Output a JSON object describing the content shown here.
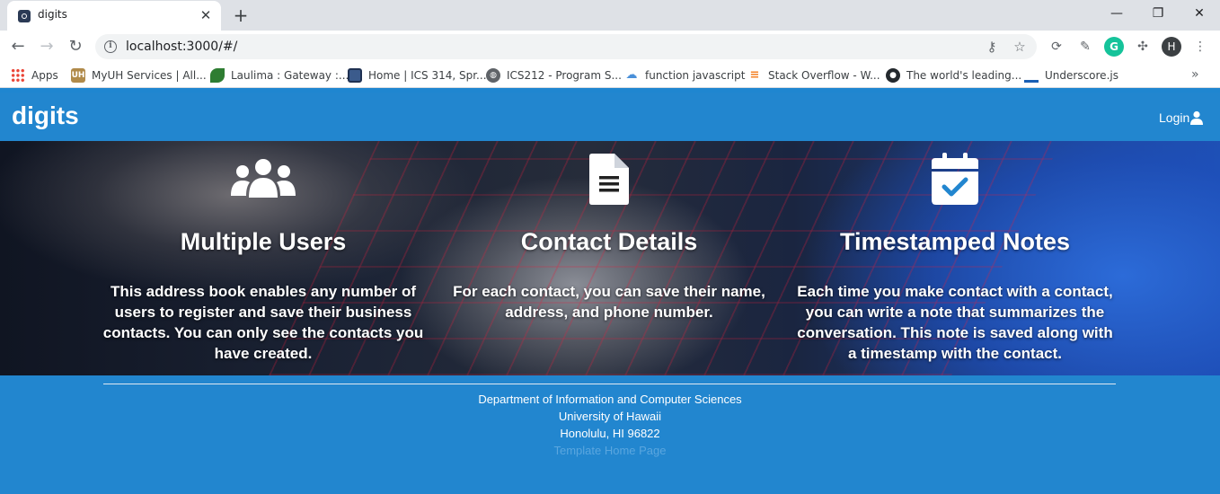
{
  "browser": {
    "tab_title": "digits",
    "tab_close": "✕",
    "new_tab": "+",
    "url": "localhost:3000/#/",
    "window_controls": {
      "minimize": "—",
      "restore": "❐",
      "close": "✕"
    },
    "nav": {
      "back": "←",
      "forward": "→",
      "reload": "↻"
    },
    "omnibox_icons": {
      "key": "⚷",
      "star": "☆"
    },
    "extensions": {
      "sync": "⟳",
      "picker": "✎",
      "grammarly": "G",
      "puzzle": "✣",
      "menu": "⋮"
    },
    "profile_initial": "H",
    "bookmarks": [
      {
        "label": "Apps",
        "icon": "apps-icon",
        "color": "#4285f4"
      },
      {
        "label": "MyUH Services | All...",
        "icon": "uh-icon",
        "color": "#b08a4a"
      },
      {
        "label": "Laulima : Gateway :...",
        "icon": "leaf-icon",
        "color": "#2e7d32"
      },
      {
        "label": "Home | ICS 314, Spr...",
        "icon": "page-icon",
        "color": "#3b5b8c"
      },
      {
        "label": "ICS212 - Program S...",
        "icon": "globe-icon",
        "color": "#5f6368"
      },
      {
        "label": "function javascript",
        "icon": "cloud-icon",
        "color": "#4a90d9"
      },
      {
        "label": "Stack Overflow - W...",
        "icon": "stackoverflow-icon",
        "color": "#f48024"
      },
      {
        "label": "The world's leading...",
        "icon": "github-icon",
        "color": "#24292e"
      },
      {
        "label": "Underscore.js",
        "icon": "underscore-icon",
        "color": "#1a5fb4"
      }
    ],
    "bookmarks_overflow": "»"
  },
  "navbar": {
    "brand": "digits",
    "login": "Login"
  },
  "features": [
    {
      "title": "Multiple Users",
      "text": "This address book enables any number of users to register and save their business contacts. You can only see the contacts you have created.",
      "icon": "users-icon"
    },
    {
      "title": "Contact Details",
      "text": "For each contact, you can save their name, address, and phone number.",
      "icon": "file-text-icon"
    },
    {
      "title": "Timestamped Notes",
      "text": "Each time you make contact with a contact, you can write a note that summarizes the conversation. This note is saved along with a timestamp with the contact.",
      "icon": "calendar-check-icon"
    }
  ],
  "footer": {
    "department": "Department of Information and Computer Sciences",
    "university": "University of Hawaii",
    "address": "Honolulu, HI 96822",
    "link": "Template Home Page"
  },
  "colors": {
    "primary": "#2286cf",
    "link": "#5aa6df"
  }
}
